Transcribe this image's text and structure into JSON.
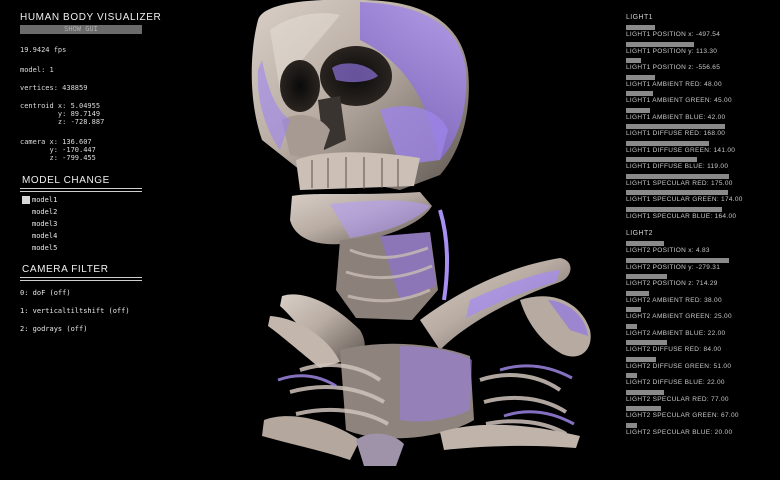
{
  "app": {
    "title": "HUMAN BODY VISUALIZER",
    "show_gui": "SHOW GUI"
  },
  "stats": {
    "fps": "19.9424 fps",
    "model": "model: 1",
    "vertices": "vertices: 438859",
    "centroid": "centroid x: 5.04955\n         y: 89.7149\n         z: -728.887",
    "camera": "camera x: 136.607\n       y: -170.447\n       z: -799.455"
  },
  "model_change": {
    "title": "MODEL CHANGE",
    "items": [
      {
        "label": "model1",
        "selected": true
      },
      {
        "label": "model2",
        "selected": false
      },
      {
        "label": "model3",
        "selected": false
      },
      {
        "label": "model4",
        "selected": false
      },
      {
        "label": "model5",
        "selected": false
      }
    ]
  },
  "camera_filter": {
    "title": "CAMERA FILTER",
    "items": [
      {
        "label": "0: doF (off)"
      },
      {
        "label": "1: verticaltiltshift (off)"
      },
      {
        "label": "2: godrays (off)"
      }
    ]
  },
  "light1": {
    "title": "LIGHT1",
    "sliders": [
      {
        "label": "LIGHT1 POSITION x: -497.54",
        "level": 0.19
      },
      {
        "label": "LIGHT1 POSITION y: 113.30",
        "level": 0.45
      },
      {
        "label": "LIGHT1 POSITION z: -556.65",
        "level": 0.1
      },
      {
        "label": "LIGHT1 AMBIENT RED: 48.00",
        "level": 0.19
      },
      {
        "label": "LIGHT1 AMBIENT GREEN: 45.00",
        "level": 0.18
      },
      {
        "label": "LIGHT1 AMBIENT BLUE: 42.00",
        "level": 0.16
      },
      {
        "label": "LIGHT1 DIFFUSE RED: 168.00",
        "level": 0.66
      },
      {
        "label": "LIGHT1 DIFFUSE GREEN: 141.00",
        "level": 0.55
      },
      {
        "label": "LIGHT1 DIFFUSE BLUE: 119.00",
        "level": 0.47
      },
      {
        "label": "LIGHT1 SPECULAR RED: 175.00",
        "level": 0.69
      },
      {
        "label": "LIGHT1 SPECULAR GREEN: 174.00",
        "level": 0.68
      },
      {
        "label": "LIGHT1 SPECULAR BLUE: 164.00",
        "level": 0.64
      }
    ]
  },
  "light2": {
    "title": "LIGHT2",
    "sliders": [
      {
        "label": "LIGHT2 POSITION x: 4.83",
        "level": 0.25
      },
      {
        "label": "LIGHT2 POSITION y: -279.31",
        "level": 0.69
      },
      {
        "label": "LIGHT2 POSITION z: 714.29",
        "level": 0.27
      },
      {
        "label": "LIGHT2 AMBIENT RED: 38.00",
        "level": 0.15
      },
      {
        "label": "LIGHT2 AMBIENT GREEN: 25.00",
        "level": 0.1
      },
      {
        "label": "LIGHT2 AMBIENT BLUE: 22.00",
        "level": 0.07
      },
      {
        "label": "LIGHT2 DIFFUSE RED: 84.00",
        "level": 0.27
      },
      {
        "label": "LIGHT2 DIFFUSE GREEN: 51.00",
        "level": 0.2
      },
      {
        "label": "LIGHT2 DIFFUSE BLUE: 22.00",
        "level": 0.07
      },
      {
        "label": "LIGHT2 SPECULAR RED: 77.00",
        "level": 0.25
      },
      {
        "label": "LIGHT2 SPECULAR GREEN: 67.00",
        "level": 0.23
      },
      {
        "label": "LIGHT2 SPECULAR BLUE: 20.00",
        "level": 0.07
      }
    ]
  },
  "colors": {
    "bone": "#c8bdb4",
    "highlight": "#9a78e6",
    "slider": "#8a8a8a",
    "background": "#000000"
  }
}
